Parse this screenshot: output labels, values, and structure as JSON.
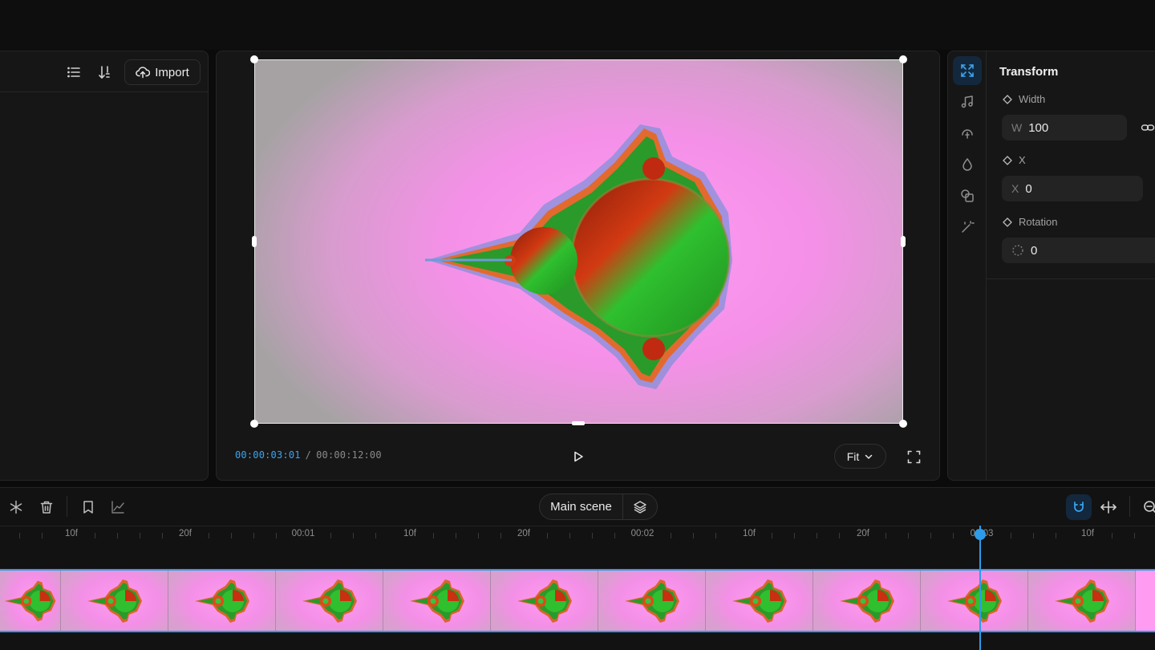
{
  "left_panel": {
    "import_label": "Import",
    "icons": [
      "list-icon",
      "sort-icon",
      "cloud-upload-icon"
    ]
  },
  "preview": {
    "time_current": "00:00:03:01",
    "time_separator": "/",
    "time_total": "00:00:12:00",
    "fit_label": "Fit",
    "icons": [
      "play-icon",
      "chevron-down-icon",
      "fullscreen-icon"
    ]
  },
  "properties": {
    "title": "Transform",
    "width_label": "Width",
    "width_prefix": "W",
    "width_value": "100",
    "x_label": "X",
    "x_prefix": "X",
    "x_value": "0",
    "rotation_label": "Rotation",
    "rotation_value": "0",
    "rail_icons": [
      "transform-icon",
      "music-icon",
      "audio-icon",
      "drop-icon",
      "shapes-icon",
      "magic-wand-icon"
    ]
  },
  "timeline": {
    "scene_label": "Main scene",
    "ruler_labels": [
      "10f",
      "20f",
      "00:01",
      "10f",
      "20f",
      "00:02",
      "10f",
      "20f",
      "00:03",
      "10f"
    ],
    "clip_thumbnail_count": 11,
    "icons": [
      "freeze-icon",
      "trash-icon",
      "bookmark-icon",
      "graph-icon",
      "layers-icon",
      "magnet-icon",
      "fit-width-icon",
      "zoom-out-icon"
    ]
  },
  "colors": {
    "accent": "#2d9bea",
    "canvas_background": "#ff9cf2",
    "panel_bg": "#161616"
  }
}
